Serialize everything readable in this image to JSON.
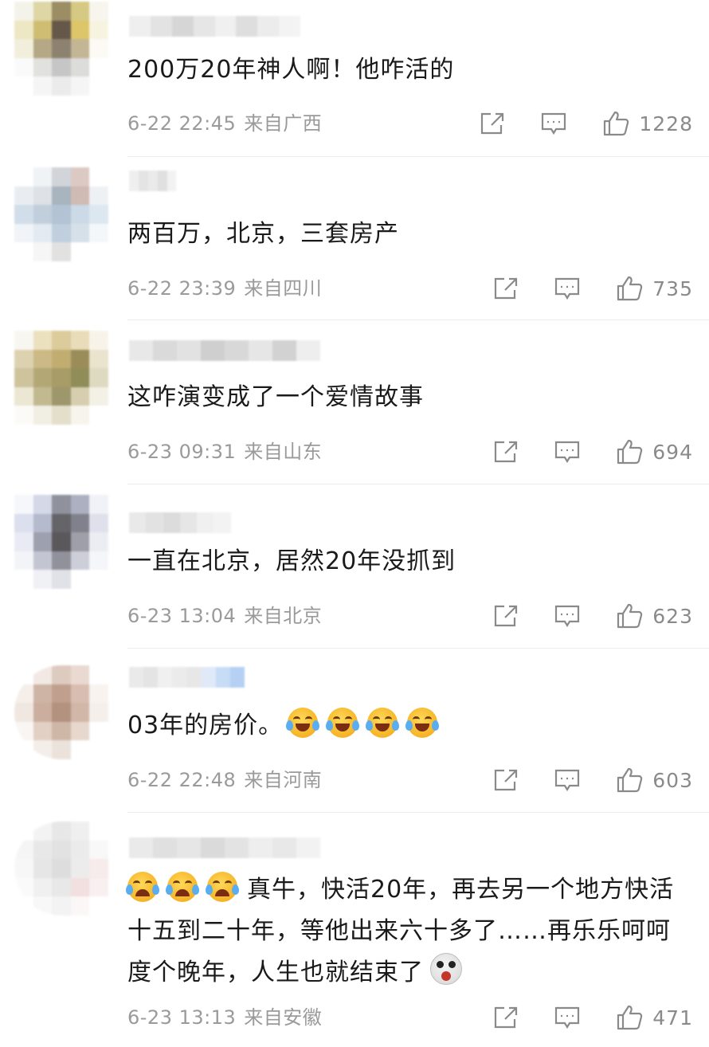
{
  "comments": [
    {
      "text": "200万20年神人啊！他咋活的",
      "date": "6-22 22:45",
      "location": "来自广西",
      "likes": "1228",
      "avatar_colors": [
        "#f3f1e6",
        "#d9cf96",
        "#8b7a4a",
        "#cfc06e",
        "#f6f4ea",
        "#eae3b9",
        "#c7b35a",
        "#4c3c2a",
        "#d8bd4f",
        "#f6f2dc",
        "#f0ecd7",
        "#a89a70",
        "#7a6c58",
        "#b8aa82",
        "#fbfaf4",
        "#fafafa",
        "#dcdcd8",
        "#bdbdbd",
        "#d6d6d4",
        "#ffffff",
        "#ffffff",
        "#f4f4f4",
        "#e8e8e8",
        "#f4f4f4",
        "#ffffff"
      ],
      "name_colors": [
        "#efefef",
        "#e3e3e3",
        "#d6d6d6",
        "#e6e6e6",
        "#f0f0f0",
        "#dedede",
        "#ececec",
        "#f3f3f3"
      ]
    },
    {
      "text": "两百万，北京，三套房产",
      "date": "6-22 23:39",
      "location": "来自四川",
      "likes": "735",
      "avatar_colors": [
        "#ffffff",
        "#eef1f4",
        "#c9ced3",
        "#d8c0b9",
        "#ffffff",
        "#e6ebf0",
        "#d9dde2",
        "#9aa7b3",
        "#c7aea7",
        "#eceff3",
        "#c9d8e6",
        "#b7c6d5",
        "#a6b9cc",
        "#c4d3e2",
        "#d7e3ee",
        "#eef2f6",
        "#dfe7ef",
        "#b4c7d9",
        "#cfdbe6",
        "#f3f6f9",
        "#ffffff",
        "#f5f5f5",
        "#dcdcdc",
        "#ffffff",
        "#ffffff"
      ],
      "name_colors": [
        "#efefef",
        "#e4e4e4",
        "#eaeaea",
        "#e0e0e0",
        "#f2f2f2",
        "#ffffff",
        "#ffffff",
        "#ffffff"
      ]
    },
    {
      "text": "这咋演变成了一个爱情故事",
      "date": "6-23 09:31",
      "location": "来自山东",
      "likes": "694",
      "avatar_colors": [
        "#f7f5ee",
        "#e9dcb5",
        "#d7c28a",
        "#e5d7ad",
        "#f6f2e6",
        "#d8cba3",
        "#c2ae72",
        "#b89f59",
        "#8a7a3d",
        "#e7dfc6",
        "#c6b98d",
        "#a69a5e",
        "#998b4d",
        "#7d7a3d",
        "#d9d4b7",
        "#e8e3cc",
        "#b8ad7e",
        "#8e8552",
        "#cfc6a0",
        "#f1eee2",
        "#fbfaf6",
        "#efece0",
        "#e0dac2",
        "#f5f3ea",
        "#ffffff"
      ],
      "name_colors": [
        "#e8e8e8",
        "#dadada",
        "#e2e2e2",
        "#cfcfcf",
        "#d8d8d8",
        "#e6e6e6",
        "#d2d2d2",
        "#eeeeee"
      ]
    },
    {
      "text": "一直在北京，居然20年没抓到",
      "date": "6-23 13:04",
      "location": "来自北京",
      "likes": "623",
      "avatar_colors": [
        "#f5f6fa",
        "#cdd2e3",
        "#7c7f8c",
        "#9ea3b6",
        "#eef0f6",
        "#d6daea",
        "#a9aec4",
        "#4a4950",
        "#6b6c78",
        "#d9dce8",
        "#e5e8f2",
        "#8d90a0",
        "#3f3c40",
        "#8e8f9a",
        "#e9ebf1",
        "#f2f3f7",
        "#b9bccb",
        "#7d7e8a",
        "#c4c6d2",
        "#f4f5f9",
        "#ffffff",
        "#eeeff4",
        "#dcdde4",
        "#ffffff",
        "#ffffff"
      ],
      "name_colors": [
        "#e9e9e9",
        "#e2e2e2",
        "#dcdcdc",
        "#e6e6e6",
        "#f0f0f0",
        "#f3f3f3",
        "#ffffff",
        "#ffffff"
      ]
    },
    {
      "text": "03年的房价。",
      "emojis": [
        "laugh",
        "laugh",
        "laugh",
        "laugh"
      ],
      "date": "6-22 22:48",
      "location": "来自河南",
      "likes": "603",
      "avatar_colors": [
        "#ffffff",
        "#f0e6e0",
        "#d9c2b6",
        "#e6d3c9",
        "#ffffff",
        "#f4ece6",
        "#c6a896",
        "#b68f7b",
        "#d1b3a3",
        "#f7f1ed",
        "#eee3dc",
        "#c2a18d",
        "#a77f6a",
        "#c9ab99",
        "#f4ede8",
        "#f8f4f1",
        "#ddc8bb",
        "#c7ab99",
        "#e3d1c5",
        "#ffffff",
        "#ffffff",
        "#f3ece7",
        "#e9ded6",
        "#ffffff",
        "#ffffff"
      ],
      "name_colors": [
        "#eaeaea",
        "#e4e4e4",
        "#f0f0f0",
        "#ebebeb",
        "#e7e7e7",
        "#dfe9f7",
        "#c7dcf5",
        "#b5d0f3"
      ]
    },
    {
      "text": "真牛，快活20年，再去另一个地方快活十五到二十年，等他出来六十多了……再乐乐呵呵度个晚年，人生也就结束了",
      "emojis_lead": [
        "cry",
        "cry",
        "cry"
      ],
      "emoji_tail": "shock",
      "date": "6-23 13:13",
      "location": "来自安徽",
      "likes": "471",
      "avatar_colors": [
        "#ffffff",
        "#f2f2f2",
        "#e3e3e3",
        "#ededed",
        "#ffffff",
        "#f4f4f4",
        "#e5e5e5",
        "#dedede",
        "#e8e8e8",
        "#f7f7f7",
        "#f6f6f6",
        "#e2e2e2",
        "#d8d8d8",
        "#e9e9e9",
        "#f6e8e8",
        "#fafafa",
        "#eeeeee",
        "#e4e4e4",
        "#f0dada",
        "#f7eeee",
        "#ffffff",
        "#f7f7f7",
        "#f1f1f1",
        "#fbf6f6",
        "#ffffff"
      ],
      "name_colors": [
        "#eaeaea",
        "#e0e0e0",
        "#e6e6e6",
        "#dadada",
        "#e3e3e3",
        "#eeeeee",
        "#e8e8e8",
        "#f2f2f2"
      ]
    }
  ],
  "icons": {
    "share": "share-icon",
    "comment": "comment-icon",
    "like": "like-icon"
  },
  "colors": {
    "text": "#1a1a1a",
    "meta": "#9a9a9a",
    "icon": "#8a8a8a"
  }
}
